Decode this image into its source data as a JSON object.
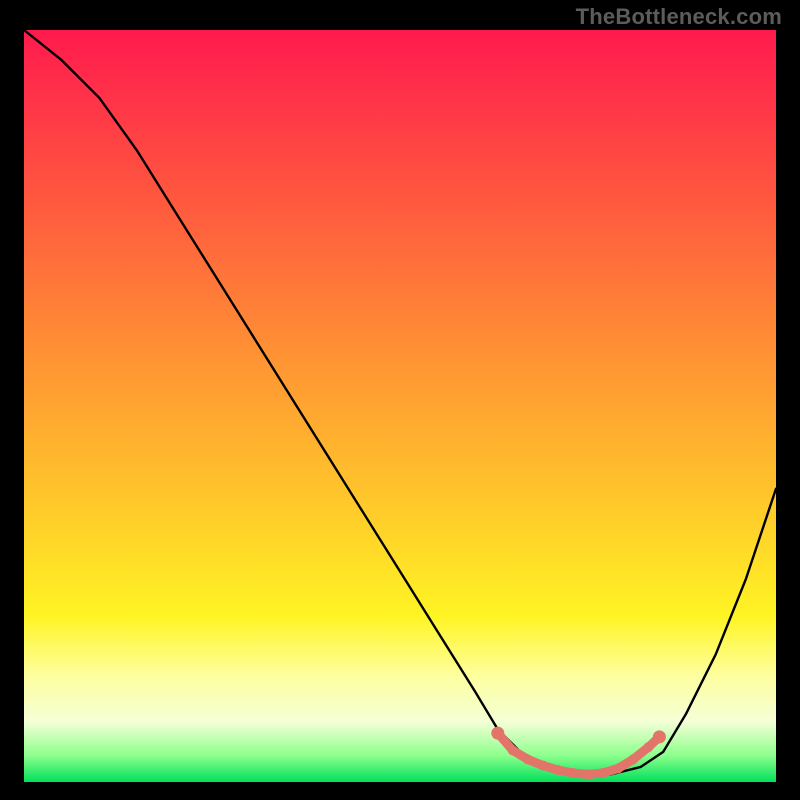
{
  "watermark": "TheBottleneck.com",
  "chart_data": {
    "type": "line",
    "title": "",
    "xlabel": "",
    "ylabel": "",
    "xlim": [
      0,
      100
    ],
    "ylim": [
      0,
      100
    ],
    "gradient_stops": [
      {
        "pos": 0,
        "color": "#ff1a4d"
      },
      {
        "pos": 8,
        "color": "#ff3049"
      },
      {
        "pos": 20,
        "color": "#ff5140"
      },
      {
        "pos": 32,
        "color": "#ff723a"
      },
      {
        "pos": 44,
        "color": "#ff9433"
      },
      {
        "pos": 56,
        "color": "#ffb52e"
      },
      {
        "pos": 68,
        "color": "#ffd728"
      },
      {
        "pos": 78,
        "color": "#fff424"
      },
      {
        "pos": 86,
        "color": "#fdffa0"
      },
      {
        "pos": 92,
        "color": "#f4ffd6"
      },
      {
        "pos": 96.5,
        "color": "#8cff8c"
      },
      {
        "pos": 100,
        "color": "#00e05c"
      }
    ],
    "series": [
      {
        "name": "bottleneck-curve",
        "x": [
          0,
          5,
          10,
          15,
          20,
          25,
          30,
          35,
          40,
          45,
          50,
          55,
          60,
          63,
          66,
          70,
          74,
          78,
          82,
          85,
          88,
          92,
          96,
          100
        ],
        "y": [
          100,
          96,
          91,
          84,
          76,
          68,
          60,
          52,
          44,
          36,
          28,
          20,
          12,
          7,
          4,
          2,
          1,
          1,
          2,
          4,
          9,
          17,
          27,
          39
        ]
      }
    ],
    "highlight_dots": {
      "name": "optimal-range",
      "color": "#e37469",
      "points": [
        {
          "x": 63,
          "y": 6.5
        },
        {
          "x": 65,
          "y": 4.2
        },
        {
          "x": 67,
          "y": 3.0
        },
        {
          "x": 69,
          "y": 2.2
        },
        {
          "x": 71,
          "y": 1.6
        },
        {
          "x": 73,
          "y": 1.2
        },
        {
          "x": 75,
          "y": 1.0
        },
        {
          "x": 77,
          "y": 1.2
        },
        {
          "x": 79,
          "y": 1.8
        },
        {
          "x": 81,
          "y": 3.0
        },
        {
          "x": 83,
          "y": 4.6
        },
        {
          "x": 84.5,
          "y": 6.0
        }
      ]
    }
  }
}
